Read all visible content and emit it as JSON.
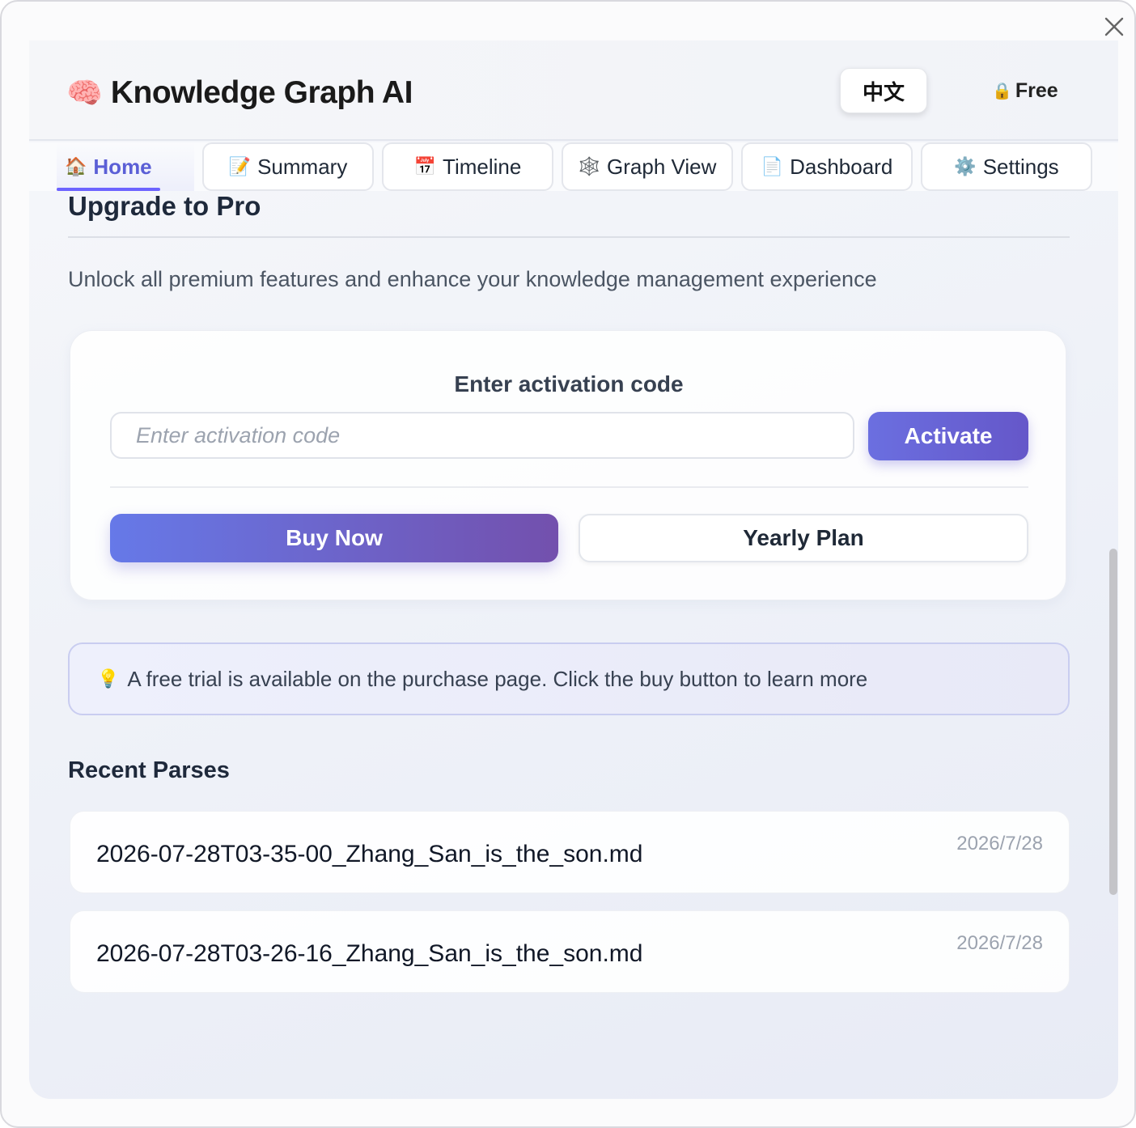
{
  "window": {
    "close_icon": "close-icon"
  },
  "header": {
    "brand_icon": "🧠",
    "title": "Knowledge Graph AI",
    "lang_button": "中文",
    "plan_icon": "🔒",
    "plan_label": "Free"
  },
  "tabs": [
    {
      "icon": "🏠",
      "label": "Home",
      "active": true
    },
    {
      "icon": "📝",
      "label": "Summary"
    },
    {
      "icon": "📅",
      "label": "Timeline"
    },
    {
      "icon": "🕸️",
      "label": "Graph View"
    },
    {
      "icon": "📄",
      "label": "Dashboard"
    },
    {
      "icon": "⚙️",
      "label": "Settings"
    }
  ],
  "upgrade": {
    "title": "Upgrade to Pro",
    "subtitle": "Unlock all premium features and enhance your knowledge management experience",
    "code_label": "Enter activation code",
    "code_placeholder": "Enter activation code",
    "code_value": "",
    "activate_label": "Activate",
    "buy_label": "Buy Now",
    "yearly_label": "Yearly Plan"
  },
  "trial": {
    "icon": "💡",
    "text": "A free trial is available on the purchase page. Click the buy button to learn more"
  },
  "recent": {
    "title": "Recent Parses",
    "items": [
      {
        "name": "2026-07-28T03-35-00_Zhang_San_is_the_son.md",
        "date": "2026/7/28"
      },
      {
        "name": "2026-07-28T03-26-16_Zhang_San_is_the_son.md",
        "date": "2026/7/28"
      }
    ]
  },
  "colors": {
    "accent": "#6c63ff",
    "activate_gradient": [
      "#6b6fe0",
      "#6557c9"
    ],
    "buy_gradient": [
      "#6679e8",
      "#7350ad"
    ]
  }
}
